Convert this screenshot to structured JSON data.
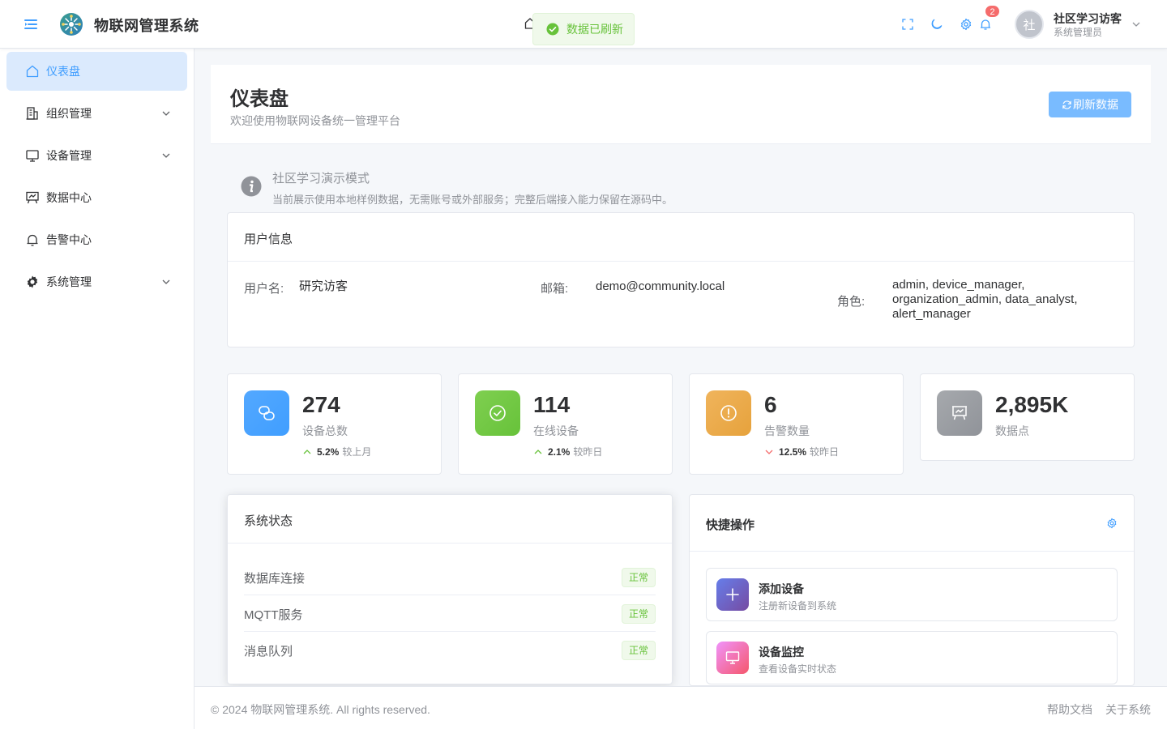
{
  "app": {
    "title": "物联网管理系统"
  },
  "toast": {
    "text": "数据已刷新",
    "color": "#67c23a"
  },
  "header": {
    "icons": [
      "fullscreen-icon",
      "moon-icon",
      "gear-icon",
      "bell-icon"
    ],
    "notification_count": "2",
    "user": {
      "avatar_text": "社",
      "name": "社区学习访客",
      "role": "系统管理员"
    }
  },
  "sidebar": {
    "items": [
      {
        "label": "仪表盘",
        "icon": "home-icon",
        "active": true,
        "expandable": false
      },
      {
        "label": "组织管理",
        "icon": "building-icon",
        "active": false,
        "expandable": true
      },
      {
        "label": "设备管理",
        "icon": "monitor-icon",
        "active": false,
        "expandable": true
      },
      {
        "label": "数据中心",
        "icon": "data-board-icon",
        "active": false,
        "expandable": false
      },
      {
        "label": "告警中心",
        "icon": "bell-icon",
        "active": false,
        "expandable": false
      },
      {
        "label": "系统管理",
        "icon": "gear-icon",
        "active": false,
        "expandable": true
      }
    ]
  },
  "page": {
    "title": "仪表盘",
    "subtitle": "欢迎使用物联网设备统一管理平台",
    "refresh_label": "刷新数据"
  },
  "demo_alert": {
    "title": "社区学习演示模式",
    "description": "当前展示使用本地样例数据，无需账号或外部服务；完整后端接入能力保留在源码中。"
  },
  "user_info": {
    "title": "用户信息",
    "username_label": "用户名:",
    "username": "研究访客",
    "email_label": "邮箱:",
    "email": "demo@community.local",
    "roles_label": "角色:",
    "roles": "admin, device_manager, organization_admin, data_analyst, alert_manager"
  },
  "stats": [
    {
      "value": "274",
      "label": "设备总数",
      "trend_dir": "up",
      "trend_value": "5.2%",
      "trend_label": "较上月",
      "color": "#409eff",
      "icon": "link-icon"
    },
    {
      "value": "114",
      "label": "在线设备",
      "trend_dir": "up",
      "trend_value": "2.1%",
      "trend_label": "较昨日",
      "color": "#67c23a",
      "icon": "check-circle-icon"
    },
    {
      "value": "6",
      "label": "告警数量",
      "trend_dir": "down",
      "trend_value": "12.5%",
      "trend_label": "较昨日",
      "color": "#e6a23c",
      "icon": "warning-icon"
    },
    {
      "value": "2,895K",
      "label": "数据点",
      "trend_dir": null,
      "trend_value": null,
      "trend_label": null,
      "color": "#909399",
      "icon": "data-board-icon"
    }
  ],
  "system_status": {
    "title": "系统状态",
    "items": [
      {
        "name": "数据库连接",
        "status": "正常"
      },
      {
        "name": "MQTT服务",
        "status": "正常"
      },
      {
        "name": "消息队列",
        "status": "正常"
      }
    ]
  },
  "quick_actions": {
    "title": "快捷操作",
    "items": [
      {
        "title": "添加设备",
        "desc": "注册新设备到系统",
        "icon": "plus-icon"
      },
      {
        "title": "设备监控",
        "desc": "查看设备实时状态",
        "icon": "monitor-icon"
      }
    ]
  },
  "footer": {
    "copyright": "© 2024 物联网管理系统. All rights reserved.",
    "links": [
      "帮助文档",
      "关于系统"
    ]
  },
  "colors": {
    "primary": "#409eff",
    "success": "#67c23a",
    "warning": "#e6a23c",
    "danger": "#f56c6c",
    "info": "#909399"
  }
}
